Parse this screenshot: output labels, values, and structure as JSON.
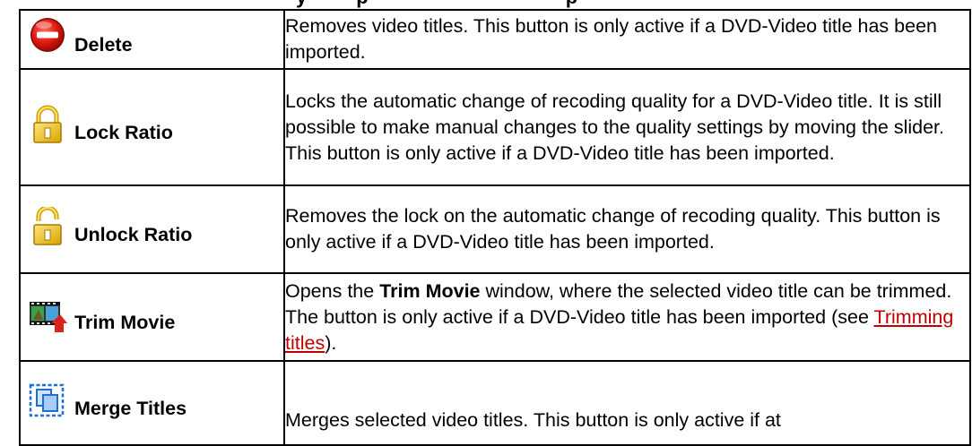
{
  "heading_fragment": "y         p                                    p",
  "rows": [
    {
      "icon": "delete-icon",
      "label": "Delete",
      "description": "Removes video titles. This button is only active if a DVD-Video title has been imported."
    },
    {
      "icon": "lock-icon",
      "label": "Lock Ratio",
      "description": "Locks the automatic change of recoding quality for a DVD-Video title. It is still possible to make manual changes to the quality settings by moving the slider. This button is only active if a DVD-Video title has been imported."
    },
    {
      "icon": "unlock-icon",
      "label": "Unlock Ratio",
      "description": "Removes the lock on the automatic change of recoding quality. This button is only active if a DVD-Video title has been imported."
    },
    {
      "icon": "trim-movie-icon",
      "label": "Trim Movie",
      "description_part1": "Opens the ",
      "description_bold": "Trim Movie",
      "description_part2": " window, where the selected video title can be trimmed. The button is only active if a DVD-Video title has been imported (see ",
      "description_link": "Trimming titles",
      "description_part3": ")."
    },
    {
      "icon": "merge-titles-icon",
      "label": "Merge Titles",
      "description": "Merges selected video titles. This button is only active if at"
    }
  ]
}
